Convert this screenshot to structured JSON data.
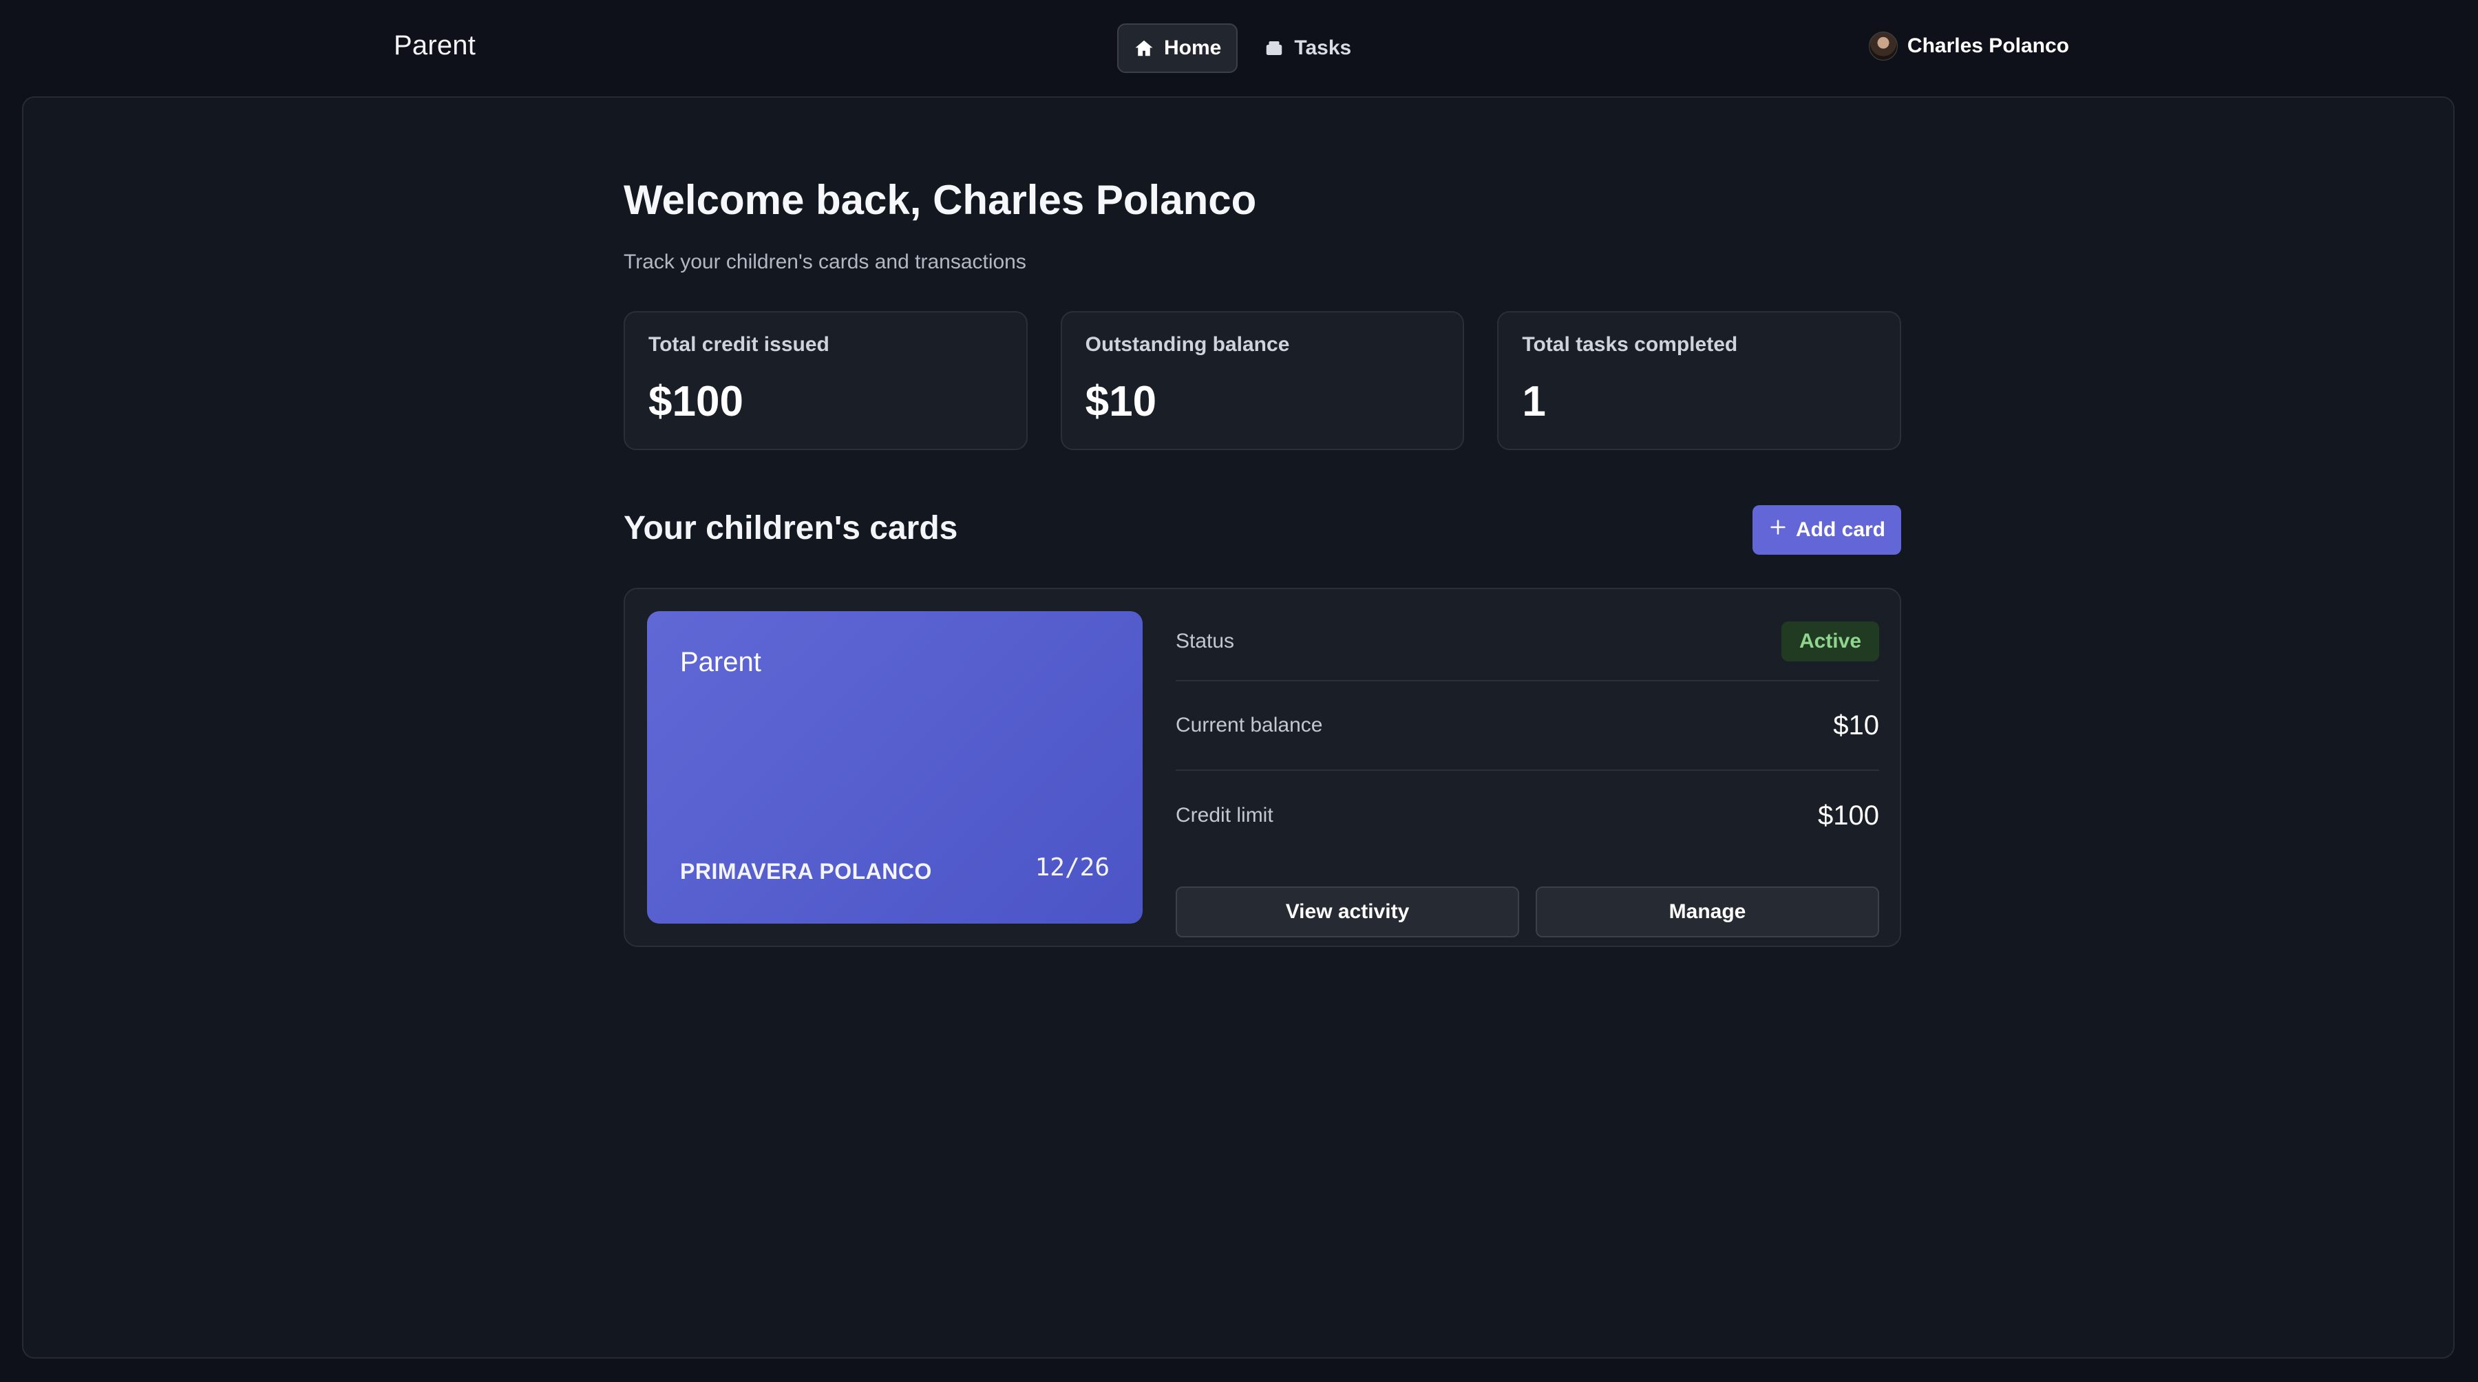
{
  "header": {
    "brand": "Parent",
    "nav": [
      {
        "label": "Home",
        "icon": "home-icon",
        "active": true
      },
      {
        "label": "Tasks",
        "icon": "tasks-icon",
        "active": false
      }
    ],
    "user_name": "Charles Polanco"
  },
  "main": {
    "welcome": "Welcome back, Charles Polanco",
    "subtitle": "Track your children's cards and transactions",
    "stats": [
      {
        "label": "Total credit issued",
        "value": "$100"
      },
      {
        "label": "Outstanding balance",
        "value": "$10"
      },
      {
        "label": "Total tasks completed",
        "value": "1"
      }
    ],
    "cards_section": {
      "title": "Your children's cards",
      "add_label": "Add card"
    },
    "card": {
      "brand": "Parent",
      "holder": "PRIMAVERA POLANCO",
      "expiry": "12/26",
      "status_label": "Status",
      "status": "Active",
      "balance_label": "Current balance",
      "balance": "$10",
      "limit_label": "Credit limit",
      "limit": "$100",
      "view_activity_label": "View activity",
      "manage_label": "Manage"
    }
  },
  "colors": {
    "background": "#0e111a",
    "panel": "#131720",
    "accent": "#6366d6",
    "status_active_bg": "#213a22",
    "status_active_text": "#8fd58e"
  }
}
